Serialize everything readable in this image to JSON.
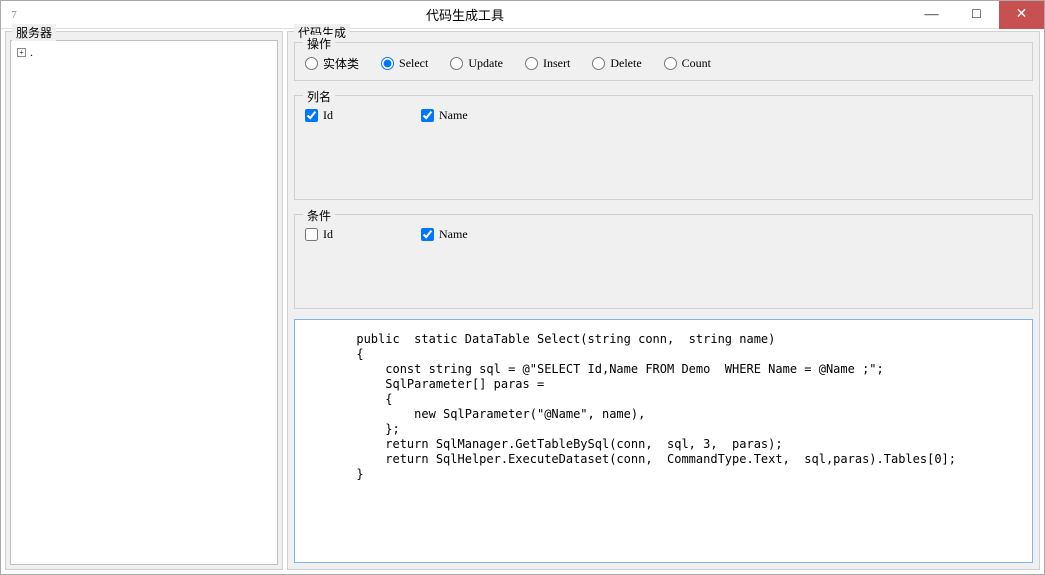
{
  "window": {
    "icon_glyph": "7",
    "title": "代码生成工具",
    "min": "—",
    "max": "□",
    "close": "✕"
  },
  "left_panel": {
    "legend": "服务器",
    "root_node": "."
  },
  "right_panel": {
    "legend": "代码生成",
    "operation_group": {
      "legend": "操作",
      "options": [
        {
          "label": "实体类",
          "checked": false
        },
        {
          "label": "Select",
          "checked": true
        },
        {
          "label": "Update",
          "checked": false
        },
        {
          "label": "Insert",
          "checked": false
        },
        {
          "label": "Delete",
          "checked": false
        },
        {
          "label": "Count",
          "checked": false
        }
      ]
    },
    "columns_group": {
      "legend": "列名",
      "items": [
        {
          "label": "Id",
          "checked": true
        },
        {
          "label": "Name",
          "checked": true
        }
      ]
    },
    "conditions_group": {
      "legend": "条件",
      "items": [
        {
          "label": "Id",
          "checked": false
        },
        {
          "label": "Name",
          "checked": true
        }
      ]
    },
    "code": "      public  static DataTable Select(string conn,  string name)\n      {\n          const string sql = @\"SELECT Id,Name FROM Demo  WHERE Name = @Name ;\";\n          SqlParameter[] paras =\n          {\n              new SqlParameter(\"@Name\", name),\n          };\n          return SqlManager.GetTableBySql(conn,  sql, 3,  paras);\n          return SqlHelper.ExecuteDataset(conn,  CommandType.Text,  sql,paras).Tables[0];\n      }"
  }
}
